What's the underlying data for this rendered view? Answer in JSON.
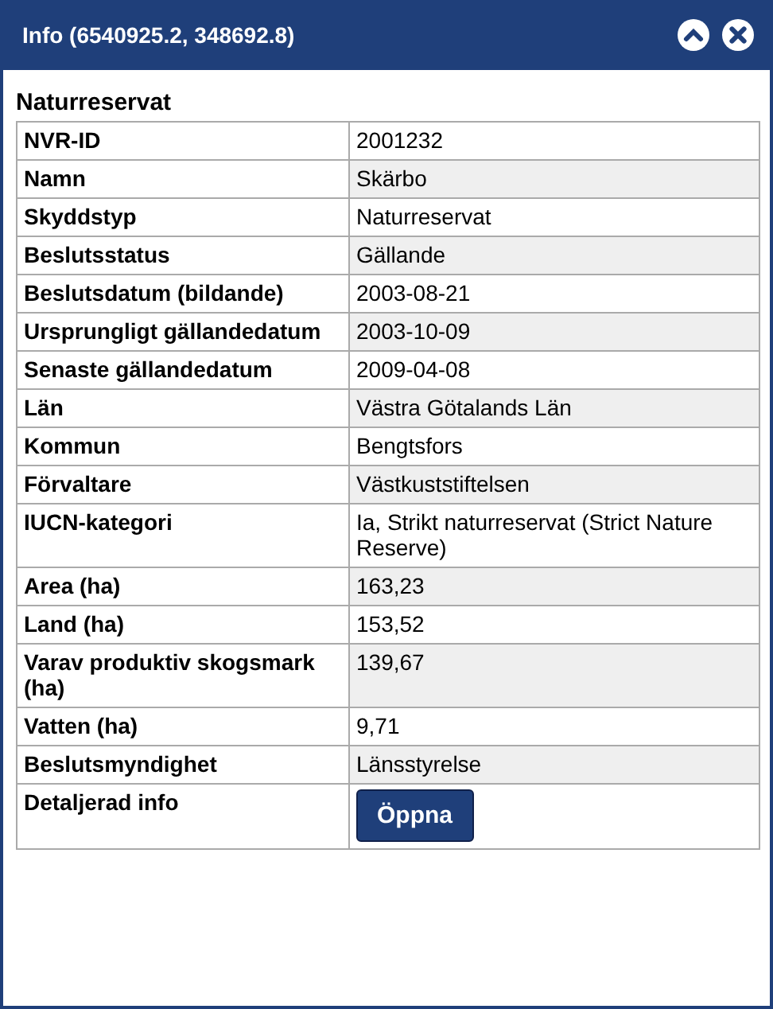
{
  "window": {
    "title": "Info (6540925.2, 348692.8)"
  },
  "heading": "Naturreservat",
  "rows": [
    {
      "label": "NVR-ID",
      "value": "2001232"
    },
    {
      "label": "Namn",
      "value": "Skärbo"
    },
    {
      "label": "Skyddstyp",
      "value": "Naturreservat"
    },
    {
      "label": "Beslutsstatus",
      "value": "Gällande"
    },
    {
      "label": "Beslutsdatum (bildande)",
      "value": "2003-08-21"
    },
    {
      "label": "Ursprungligt gällandedatum",
      "value": "2003-10-09"
    },
    {
      "label": "Senaste gällandedatum",
      "value": "2009-04-08"
    },
    {
      "label": "Län",
      "value": "Västra Götalands Län"
    },
    {
      "label": "Kommun",
      "value": "Bengtsfors"
    },
    {
      "label": "Förvaltare",
      "value": "Västkuststiftelsen"
    },
    {
      "label": "IUCN-kategori",
      "value": "Ia, Strikt naturreservat (Strict Nature Reserve)"
    },
    {
      "label": "Area (ha)",
      "value": "163,23"
    },
    {
      "label": "Land (ha)",
      "value": "153,52"
    },
    {
      "label": "Varav produktiv skogsmark (ha)",
      "value": "139,67"
    },
    {
      "label": "Vatten (ha)",
      "value": "9,71"
    },
    {
      "label": "Beslutsmyndighet",
      "value": "Länsstyrelse"
    },
    {
      "label": "Detaljerad info",
      "kind": "button",
      "button": "Öppna"
    }
  ]
}
